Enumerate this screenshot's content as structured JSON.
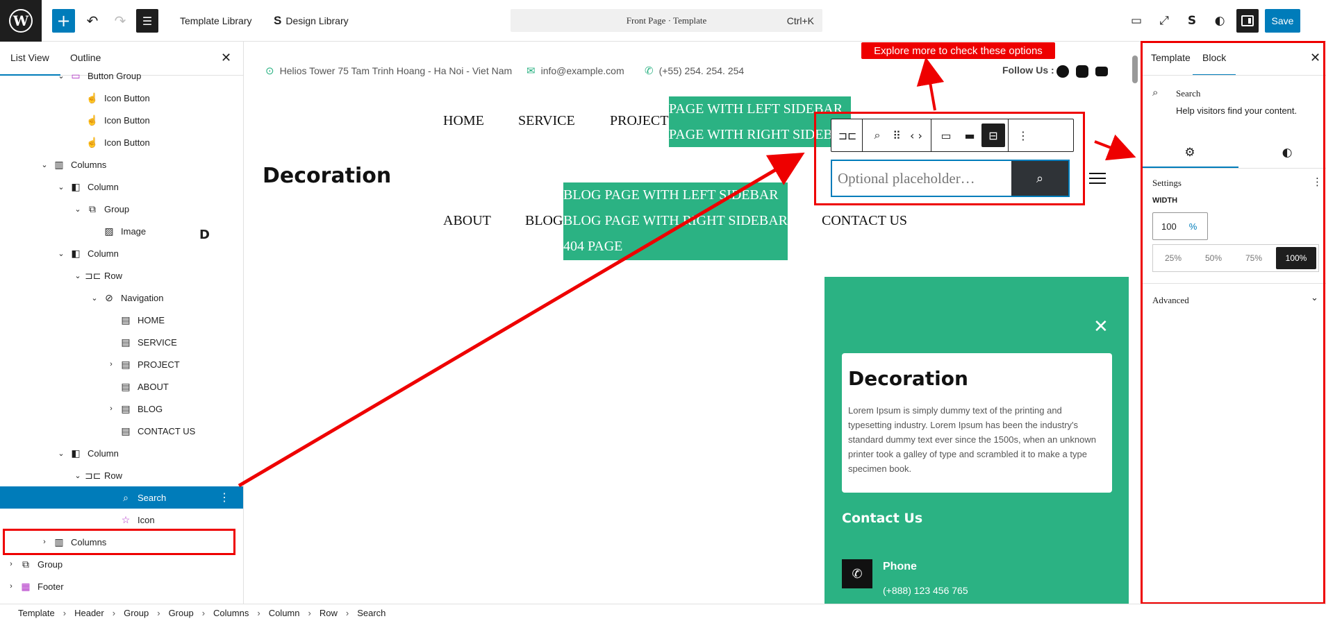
{
  "topbar": {
    "template_library": "Template Library",
    "design_library": "Design Library",
    "command_center": "Front Page · Template",
    "shortcut": "Ctrl+K",
    "save": "Save"
  },
  "list_view": {
    "tabs": [
      "List View",
      "Outline"
    ],
    "rows": [
      {
        "label": "Button Group",
        "indent": 3,
        "chevron": "⌄",
        "icon": "▭"
      },
      {
        "label": "Icon Button",
        "indent": 4,
        "chevron": "",
        "icon": "☝"
      },
      {
        "label": "Icon Button",
        "indent": 4,
        "chevron": "",
        "icon": "☝"
      },
      {
        "label": "Icon Button",
        "indent": 4,
        "chevron": "",
        "icon": "☝"
      },
      {
        "label": "Columns",
        "indent": 2,
        "chevron": "⌄",
        "icon": "▥"
      },
      {
        "label": "Column",
        "indent": 3,
        "chevron": "⌄",
        "icon": "◧"
      },
      {
        "label": "Group",
        "indent": 4,
        "chevron": "⌄",
        "icon": "⧉"
      },
      {
        "label": "Image",
        "indent": 5,
        "chevron": "",
        "icon": "▨"
      },
      {
        "label": "Column",
        "indent": 3,
        "chevron": "⌄",
        "icon": "◧"
      },
      {
        "label": "Row",
        "indent": 4,
        "chevron": "⌄",
        "icon": "⊐⊏"
      },
      {
        "label": "Navigation",
        "indent": 5,
        "chevron": "⌄",
        "icon": "⊘"
      },
      {
        "label": "HOME",
        "indent": 6,
        "chevron": "",
        "icon": "▤"
      },
      {
        "label": "SERVICE",
        "indent": 6,
        "chevron": "",
        "icon": "▤"
      },
      {
        "label": "PROJECT",
        "indent": 6,
        "chevron": "›",
        "icon": "▤"
      },
      {
        "label": "ABOUT",
        "indent": 6,
        "chevron": "",
        "icon": "▤"
      },
      {
        "label": "BLOG",
        "indent": 6,
        "chevron": "›",
        "icon": "▤"
      },
      {
        "label": "CONTACT US",
        "indent": 6,
        "chevron": "",
        "icon": "▤"
      },
      {
        "label": "Column",
        "indent": 3,
        "chevron": "⌄",
        "icon": "◧"
      },
      {
        "label": "Row",
        "indent": 4,
        "chevron": "⌄",
        "icon": "⊐⊏"
      },
      {
        "label": "Search",
        "indent": 6,
        "chevron": "",
        "icon": "⌕"
      },
      {
        "label": "Icon",
        "indent": 6,
        "chevron": "",
        "icon": "☆"
      },
      {
        "label": "Columns",
        "indent": 2,
        "chevron": "›",
        "icon": "▥"
      },
      {
        "label": "Group",
        "indent": 0,
        "chevron": "›",
        "icon": "⧉"
      },
      {
        "label": "Footer",
        "indent": 0,
        "chevron": "›",
        "icon": "▦"
      }
    ],
    "image_preview": "D"
  },
  "header": {
    "address": "Helios Tower 75 Tam Trinh Hoang - Ha Noi - Viet Nam",
    "email": "info@example.com",
    "phone": "(+55) 254. 254. 254",
    "follow_us": "Follow Us :",
    "site_title": "Decoration",
    "menu": {
      "home": "HOME",
      "service": "SERVICE",
      "project": "PROJECT",
      "about": "ABOUT",
      "blog": "BLOG",
      "contact": "CONTACT US"
    },
    "project_submenu": [
      "PAGE WITH LEFT SIDEBAR",
      "PAGE WITH RIGHT SIDEBAR"
    ],
    "blog_submenu": [
      "BLOG PAGE WITH LEFT SIDEBAR",
      "BLOG PAGE WITH RIGHT SIDEBAR",
      "404 PAGE"
    ],
    "search_placeholder": "Optional placeholder…"
  },
  "offcanvas": {
    "card_title": "Decoration",
    "card_text": "Lorem Ipsum is simply dummy text of the printing and typesetting industry. Lorem Ipsum has been the industry's standard dummy text ever since the 1500s, when an unknown printer took a galley of type and scrambled it to make a type specimen book.",
    "contact_title": "Contact Us",
    "phone_label": "Phone",
    "phone_number": "(+888) 123 456 765"
  },
  "annotation": "Explore more to check these options",
  "sidebar": {
    "tabs": [
      "Template",
      "Block"
    ],
    "block_name": "Search",
    "block_desc": "Help visitors find your content.",
    "settings": "Settings",
    "width_label": "WIDTH",
    "width_value": "100",
    "width_unit": "%",
    "presets": [
      "25%",
      "50%",
      "75%",
      "100%"
    ],
    "advanced": "Advanced"
  },
  "breadcrumb": [
    "Template",
    "Header",
    "Group",
    "Group",
    "Columns",
    "Column",
    "Row",
    "Search"
  ],
  "colors": {
    "accent": "#007cba",
    "brand_green": "#2bb283",
    "annotation_red": "#e00000"
  }
}
